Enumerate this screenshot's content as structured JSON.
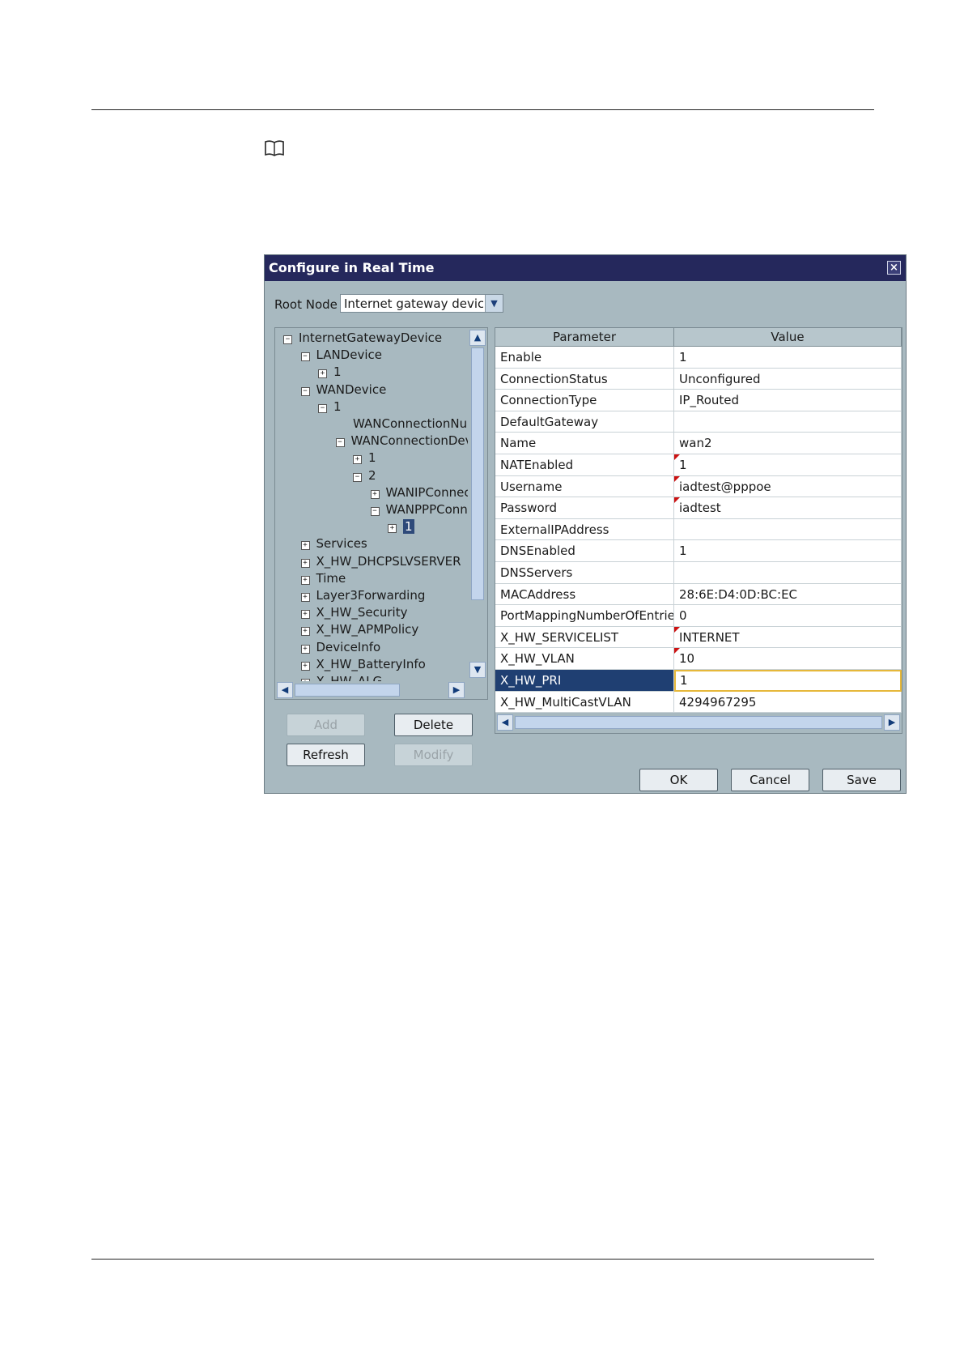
{
  "dialog": {
    "title": "Configure in Real Time",
    "close_glyph": "×",
    "root_node_label": "Root Node",
    "root_node_value": "Internet gateway device"
  },
  "tree": [
    {
      "label": "InternetGatewayDevice",
      "toggle": "−",
      "level": 0
    },
    {
      "label": "LANDevice",
      "toggle": "−",
      "level": 1
    },
    {
      "label": "1",
      "toggle": "+",
      "level": 2
    },
    {
      "label": "WANDevice",
      "toggle": "−",
      "level": 1
    },
    {
      "label": "1",
      "toggle": "−",
      "level": 2
    },
    {
      "label": "WANConnectionNumberOfEntries",
      "toggle": "",
      "level": 4
    },
    {
      "label": "WANConnectionDevice",
      "toggle": "−",
      "level": 3
    },
    {
      "label": "1",
      "toggle": "+",
      "level": 4
    },
    {
      "label": "2",
      "toggle": "−",
      "level": 4
    },
    {
      "label": "WANIPConnection",
      "toggle": "+",
      "level": 5
    },
    {
      "label": "WANPPPConnection",
      "toggle": "−",
      "level": 5
    },
    {
      "label": "1",
      "toggle": "+",
      "level": 6,
      "selected": true
    },
    {
      "label": "Services",
      "toggle": "+",
      "level": 1
    },
    {
      "label": "X_HW_DHCPSLVSERVER",
      "toggle": "+",
      "level": 1
    },
    {
      "label": "Time",
      "toggle": "+",
      "level": 1
    },
    {
      "label": "Layer3Forwarding",
      "toggle": "+",
      "level": 1
    },
    {
      "label": "X_HW_Security",
      "toggle": "+",
      "level": 1
    },
    {
      "label": "X_HW_APMPolicy",
      "toggle": "+",
      "level": 1
    },
    {
      "label": "DeviceInfo",
      "toggle": "+",
      "level": 1
    },
    {
      "label": "X_HW_BatteryInfo",
      "toggle": "+",
      "level": 1
    },
    {
      "label": "X_HW_ALG",
      "toggle": "+",
      "level": 1
    }
  ],
  "buttons": {
    "add": "Add",
    "delete": "Delete",
    "refresh": "Refresh",
    "modify": "Modify",
    "ok": "OK",
    "cancel": "Cancel",
    "save": "Save"
  },
  "grid": {
    "headers": [
      "Parameter",
      "Value"
    ],
    "rows": [
      {
        "parameter": "Enable",
        "value": "1",
        "modified": false
      },
      {
        "parameter": "ConnectionStatus",
        "value": "Unconfigured",
        "modified": false
      },
      {
        "parameter": "ConnectionType",
        "value": "IP_Routed",
        "modified": false
      },
      {
        "parameter": "DefaultGateway",
        "value": "",
        "modified": false
      },
      {
        "parameter": "Name",
        "value": "wan2",
        "modified": false
      },
      {
        "parameter": "NATEnabled",
        "value": "1",
        "modified": true
      },
      {
        "parameter": "Username",
        "value": "iadtest@pppoe",
        "modified": true
      },
      {
        "parameter": "Password",
        "value": "iadtest",
        "modified": true
      },
      {
        "parameter": "ExternalIPAddress",
        "value": "",
        "modified": false
      },
      {
        "parameter": "DNSEnabled",
        "value": "1",
        "modified": false
      },
      {
        "parameter": "DNSServers",
        "value": "",
        "modified": false
      },
      {
        "parameter": "MACAddress",
        "value": "28:6E:D4:0D:BC:EC",
        "modified": false
      },
      {
        "parameter": "PortMappingNumberOfEntries",
        "value": "0",
        "modified": false
      },
      {
        "parameter": "X_HW_SERVICELIST",
        "value": "INTERNET",
        "modified": true
      },
      {
        "parameter": "X_HW_VLAN",
        "value": "10",
        "modified": true
      },
      {
        "parameter": "X_HW_PRI",
        "value": "1",
        "modified": false,
        "selected": true
      },
      {
        "parameter": "X_HW_MultiCastVLAN",
        "value": "4294967295",
        "modified": false
      }
    ]
  },
  "colors": {
    "title_bar": "#25285c",
    "dialog_bg": "#a8b9c0",
    "selected_row": "#1f3f72",
    "edit_border": "#e6b83a",
    "modified_flag": "#cc1111"
  }
}
